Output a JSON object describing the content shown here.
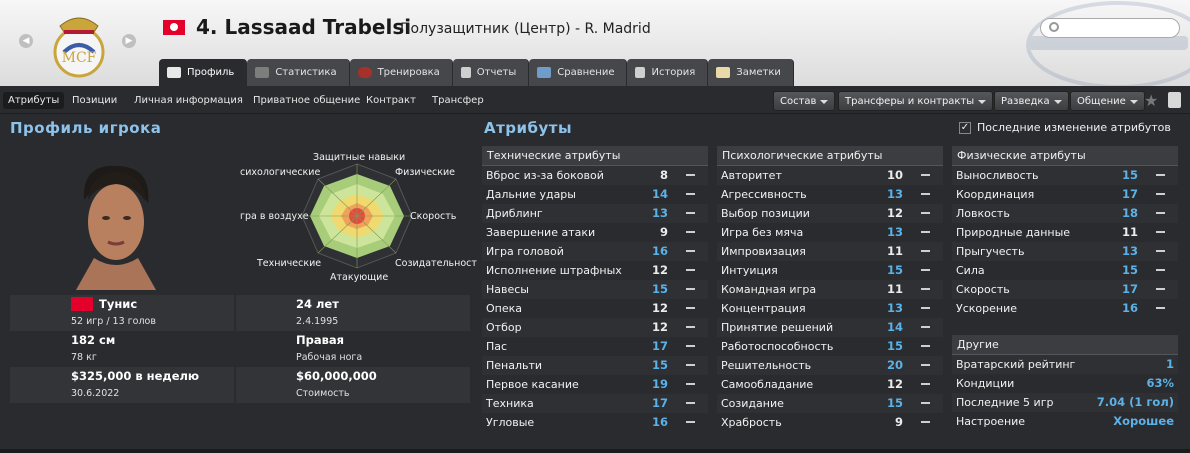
{
  "header": {
    "player_name": "4. Lassaad Trabelsi",
    "player_role": "Полузащитник (Центр) - R. Madrid",
    "search_placeholder": ""
  },
  "tabs": [
    {
      "label": "Профиль",
      "active": true
    },
    {
      "label": "Статистика"
    },
    {
      "label": "Тренировка"
    },
    {
      "label": "Отчеты"
    },
    {
      "label": "Сравнение"
    },
    {
      "label": "История"
    },
    {
      "label": "Заметки"
    }
  ],
  "subnav": [
    {
      "label": "Атрибуты",
      "active": true
    },
    {
      "label": "Позиции"
    },
    {
      "label": "Личная информация"
    },
    {
      "label": "Приватное общение"
    },
    {
      "label": "Контракт"
    },
    {
      "label": "Трансфер"
    }
  ],
  "dropdowns": [
    "Состав",
    "Трансферы и контракты",
    "Разведка",
    "Общение"
  ],
  "profile": {
    "title": "Профиль игрока",
    "radar_labels": {
      "top": "Защитные навыки",
      "top_left": "сихологические",
      "top_right": "Физические",
      "left": "гра в воздухе",
      "right": "Скорость",
      "bottom_left": "Технические",
      "bottom": "Атакующие",
      "bottom_right": "Созидательност"
    },
    "nationality": "Тунис",
    "apps": "52 игр / 13 голов",
    "age": "24 лет",
    "dob": "2.4.1995",
    "height": "182 см",
    "weight": "78 кг",
    "foot": "Правая",
    "foot_label": "Рабочая нога",
    "wage": "$325,000 в неделю",
    "contract_end": "30.6.2022",
    "value": "$60,000,000",
    "value_label": "Стоимость"
  },
  "attributes": {
    "title": "Атрибуты",
    "recent_changes_label": "Последние изменение атрибутов",
    "recent_changes_checked": true,
    "technical": {
      "header": "Технические атрибуты",
      "items": [
        {
          "name": "Вброс из-за боковой",
          "value": "8"
        },
        {
          "name": "Дальние удары",
          "value": "14"
        },
        {
          "name": "Дриблинг",
          "value": "13"
        },
        {
          "name": "Завершение атаки",
          "value": "9"
        },
        {
          "name": "Игра головой",
          "value": "16"
        },
        {
          "name": "Исполнение штрафных",
          "value": "12"
        },
        {
          "name": "Навесы",
          "value": "15"
        },
        {
          "name": "Опека",
          "value": "12"
        },
        {
          "name": "Отбор",
          "value": "12"
        },
        {
          "name": "Пас",
          "value": "17"
        },
        {
          "name": "Пенальти",
          "value": "15"
        },
        {
          "name": "Первое касание",
          "value": "19"
        },
        {
          "name": "Техника",
          "value": "17"
        },
        {
          "name": "Угловые",
          "value": "16"
        }
      ]
    },
    "mental": {
      "header": "Психологические атрибуты",
      "items": [
        {
          "name": "Авторитет",
          "value": "10"
        },
        {
          "name": "Агрессивность",
          "value": "13"
        },
        {
          "name": "Выбор позиции",
          "value": "12"
        },
        {
          "name": "Игра без мяча",
          "value": "13"
        },
        {
          "name": "Импровизация",
          "value": "11"
        },
        {
          "name": "Интуиция",
          "value": "15"
        },
        {
          "name": "Командная игра",
          "value": "11"
        },
        {
          "name": "Концентрация",
          "value": "13"
        },
        {
          "name": "Принятие решений",
          "value": "14"
        },
        {
          "name": "Работоспособность",
          "value": "15"
        },
        {
          "name": "Решительность",
          "value": "20"
        },
        {
          "name": "Самообладание",
          "value": "12"
        },
        {
          "name": "Созидание",
          "value": "15"
        },
        {
          "name": "Храбрость",
          "value": "9"
        }
      ]
    },
    "physical": {
      "header": "Физические атрибуты",
      "items": [
        {
          "name": "Выносливость",
          "value": "15"
        },
        {
          "name": "Координация",
          "value": "17"
        },
        {
          "name": "Ловкость",
          "value": "18"
        },
        {
          "name": "Природные данные",
          "value": "11"
        },
        {
          "name": "Прыгучесть",
          "value": "13"
        },
        {
          "name": "Сила",
          "value": "15"
        },
        {
          "name": "Скорость",
          "value": "17"
        },
        {
          "name": "Ускорение",
          "value": "16"
        }
      ]
    },
    "other": {
      "header": "Другие",
      "items": [
        {
          "name": "Вратарский рейтинг",
          "value": "1"
        },
        {
          "name": "Кондиции",
          "value": "63%"
        },
        {
          "name": "Последние 5 игр",
          "value": "7.04 (1 гол)"
        },
        {
          "name": "Настроение",
          "value": "Хорошее"
        }
      ]
    }
  },
  "colors": {
    "accent_title": "#8dc2ea",
    "value_high": "#5ab2e8",
    "value_normal": "#ececec",
    "flag_red": "#e3002b"
  }
}
